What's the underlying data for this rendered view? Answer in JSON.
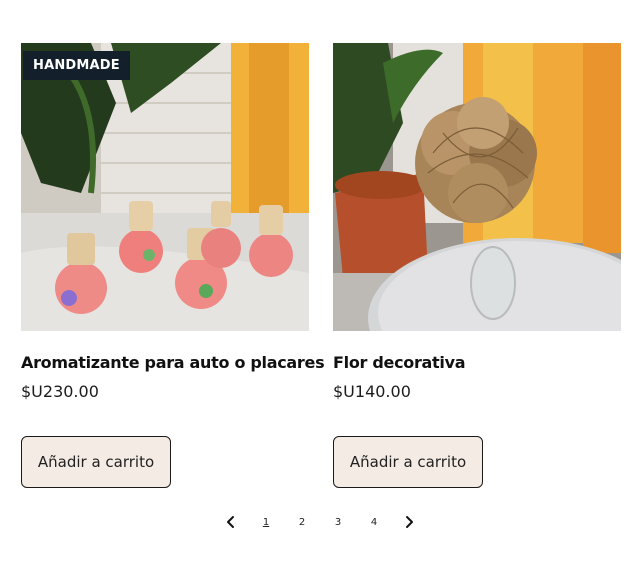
{
  "products": [
    {
      "badge": "HANDMADE",
      "title": "Aromatizante para auto o placares",
      "price": "$U230.00",
      "button": "Añadir a carrito",
      "image": "car-air-freshener-bottles-photo"
    },
    {
      "badge": "",
      "title": "Flor decorativa",
      "price": "$U140.00",
      "button": "Añadir a carrito",
      "image": "jute-flower-vase-photo"
    }
  ],
  "pagination": {
    "prev_icon": "chevron-left-icon",
    "next_icon": "chevron-right-icon",
    "pages": [
      "1",
      "2",
      "3",
      "4"
    ],
    "current": "1"
  },
  "colors": {
    "badge_bg": "#13202b",
    "button_bg": "#f4ece4",
    "button_border": "#1a1a1a"
  }
}
